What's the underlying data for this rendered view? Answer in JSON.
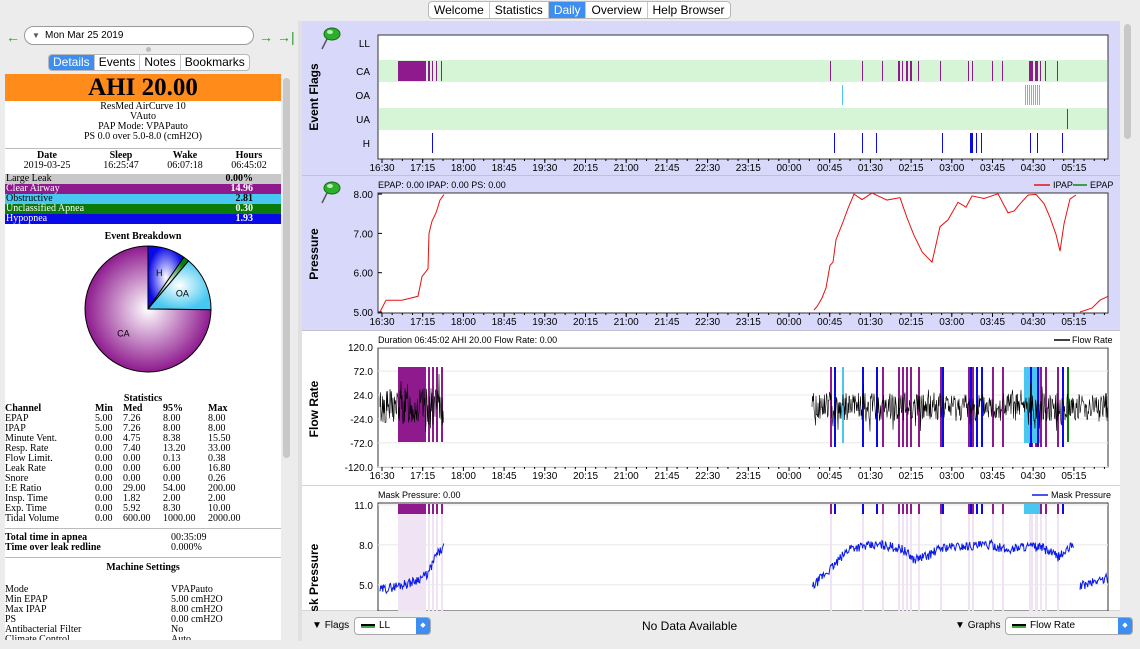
{
  "tabs": [
    "Welcome",
    "Statistics",
    "Daily",
    "Overview",
    "Help Browser"
  ],
  "active_tab": "Daily",
  "nav": {
    "date": "Mon Mar 25 2019"
  },
  "subtabs": [
    "Details",
    "Events",
    "Notes",
    "Bookmarks"
  ],
  "active_subtab": "Details",
  "details": {
    "ahi": "AHI 20.00",
    "machine": "ResMed AirCurve 10",
    "mode_short": "VAuto",
    "pap_mode": "PAP Mode: VPAPauto",
    "ps": "PS 0.0 over 5.0-8.0 (cmH2O)",
    "session": {
      "headers": [
        "Date",
        "Sleep",
        "Wake",
        "Hours"
      ],
      "values": [
        "2019-03-25",
        "16:25:47",
        "06:07:18",
        "06:45:02"
      ]
    },
    "summary": [
      {
        "label": "Large Leak",
        "value": "0.00%",
        "color": "#c8c8c8",
        "light": false
      },
      {
        "label": "Clear Airway",
        "value": "14.96",
        "color": "#8e1a8e",
        "light": true
      },
      {
        "label": "Obstructive",
        "value": "2.81",
        "color": "#48c8f0",
        "light": false
      },
      {
        "label": "Unclassified Apnea",
        "value": "0.30",
        "color": "#0a7a0a",
        "light": true
      },
      {
        "label": "Hypopnea",
        "value": "1.93",
        "color": "#0a0ae8",
        "light": true
      }
    ],
    "event_breakdown_title": "Event Breakdown",
    "pie": {
      "slices": [
        {
          "label": "CA",
          "value": 14.96,
          "color": "#8e1a8e"
        },
        {
          "label": "OA",
          "value": 2.81,
          "color": "#48c8f0"
        },
        {
          "label": "",
          "value": 0.3,
          "color": "#0a7a0a"
        },
        {
          "label": "H",
          "value": 1.93,
          "color": "#0a0ae8"
        }
      ]
    },
    "statistics_title": "Statistics",
    "stats_headers": [
      "Channel",
      "Min",
      "Med",
      "95%",
      "Max"
    ],
    "stats": [
      [
        "EPAP",
        "5.00",
        "7.26",
        "8.00",
        "8.00"
      ],
      [
        "IPAP",
        "5.00",
        "7.26",
        "8.00",
        "8.00"
      ],
      [
        "Minute Vent.",
        "0.00",
        "4.75",
        "8.38",
        "15.50"
      ],
      [
        "Resp. Rate",
        "0.00",
        "7.40",
        "13.20",
        "33.00"
      ],
      [
        "Flow Limit.",
        "0.00",
        "0.00",
        "0.13",
        "0.38"
      ],
      [
        "Leak Rate",
        "0.00",
        "0.00",
        "6.00",
        "16.80"
      ],
      [
        "Snore",
        "0.00",
        "0.00",
        "0.00",
        "0.26"
      ],
      [
        "I:E Ratio",
        "0.00",
        "29.00",
        "54.00",
        "200.00"
      ],
      [
        "Insp. Time",
        "0.00",
        "1.82",
        "2.00",
        "2.00"
      ],
      [
        "Exp. Time",
        "0.00",
        "5.92",
        "8.30",
        "10.00"
      ],
      [
        "Tidal Volume",
        "0.00",
        "600.00",
        "1000.00",
        "2000.00"
      ]
    ],
    "apnea_time_label": "Total time in apnea",
    "apnea_time": "00:35:09",
    "leak_label": "Time over leak redline",
    "leak_value": "0.000%",
    "machine_settings_title": "Machine Settings",
    "settings": [
      [
        "Mode",
        "VPAPauto"
      ],
      [
        "Min EPAP",
        "5.00 cmH2O"
      ],
      [
        "Max IPAP",
        "8.00 cmH2O"
      ],
      [
        "PS",
        "0.00 cmH2O"
      ],
      [
        "Antibacterial Filter",
        "No"
      ],
      [
        "Climate Control",
        "Auto"
      ]
    ]
  },
  "time_ticks": [
    "16:30",
    "17:15",
    "18:00",
    "18:45",
    "19:30",
    "20:15",
    "21:00",
    "21:45",
    "22:30",
    "23:15",
    "00:00",
    "00:45",
    "01:30",
    "02:15",
    "03:00",
    "03:45",
    "04:30",
    "05:15"
  ],
  "event_flags": {
    "title": "Event Flags",
    "rows": [
      "LL",
      "CA",
      "OA",
      "UA",
      "H"
    ]
  },
  "pressure": {
    "title": "Pressure",
    "header": "EPAP: 0.00 IPAP: 0.00 PS: 0.00",
    "legend": [
      "IPAP",
      "EPAP"
    ],
    "yticks": [
      "8.00",
      "7.00",
      "6.00",
      "5.00"
    ]
  },
  "flow": {
    "title": "Flow Rate",
    "header": "Duration 06:45:02 AHI 20.00 Flow Rate: 0.00",
    "legend": "Flow Rate",
    "yticks": [
      "120.0",
      "72.0",
      "24.0",
      "-24.0",
      "-72.0",
      "-120.0"
    ]
  },
  "mask": {
    "title": "Mask Pressure",
    "header": "Mask Pressure: 0.00",
    "legend": "Mask Pressure",
    "yticks": [
      "11.0",
      "8.0",
      "5.0"
    ]
  },
  "bottom": {
    "flags_label": "Flags",
    "flags_value": "LL",
    "status": "No Data Available",
    "graphs_label": "Graphs",
    "graphs_value": "Flow Rate"
  },
  "colors": {
    "ca": "#8e1a8e",
    "oa": "#48c8f0",
    "ua": "#0a7a0a",
    "h": "#0a0ae8",
    "ipap": "#e81010",
    "epap": "#0a8a0a",
    "mask": "#0a1ae8",
    "accent": "#3d8ef0",
    "orange": "#ff8c1a"
  }
}
